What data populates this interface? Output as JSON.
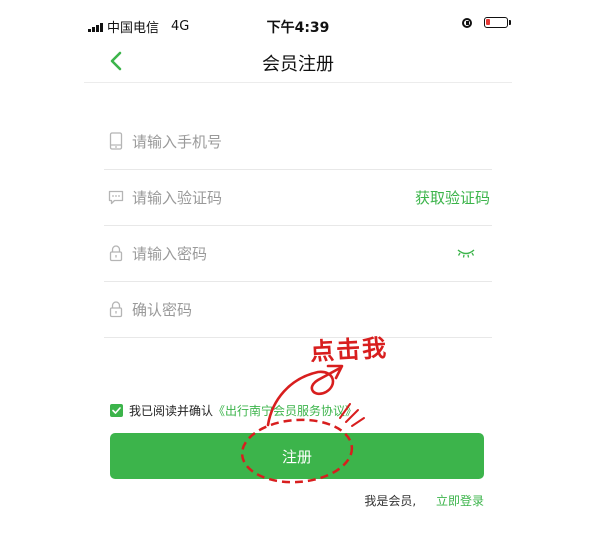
{
  "status_bar": {
    "carrier": "中国电信",
    "network": "4G",
    "time": "下午4:39",
    "battery_level": 0.2
  },
  "nav": {
    "title": "会员注册",
    "back_icon": "chevron-left-icon"
  },
  "form": {
    "phone": {
      "placeholder": "请输入手机号",
      "value": "",
      "icon": "phone-icon"
    },
    "code": {
      "placeholder": "请输入验证码",
      "value": "",
      "icon": "message-icon",
      "action_label": "获取验证码"
    },
    "password": {
      "placeholder": "请输入密码",
      "value": "",
      "icon": "lock-icon",
      "toggle_icon": "eye-closed-icon"
    },
    "confirm": {
      "placeholder": "确认密码",
      "value": "",
      "icon": "lock-icon"
    }
  },
  "agreement": {
    "checked": true,
    "text": "我已阅读并确认",
    "link": "《出行南宁会员服务协议》"
  },
  "register_label": "注册",
  "login": {
    "question": "我是会员,",
    "link": "立即登录"
  },
  "annotation": {
    "text": "点击我"
  },
  "colors": {
    "accent": "#3cb44b",
    "annotation": "#d81e1e"
  }
}
